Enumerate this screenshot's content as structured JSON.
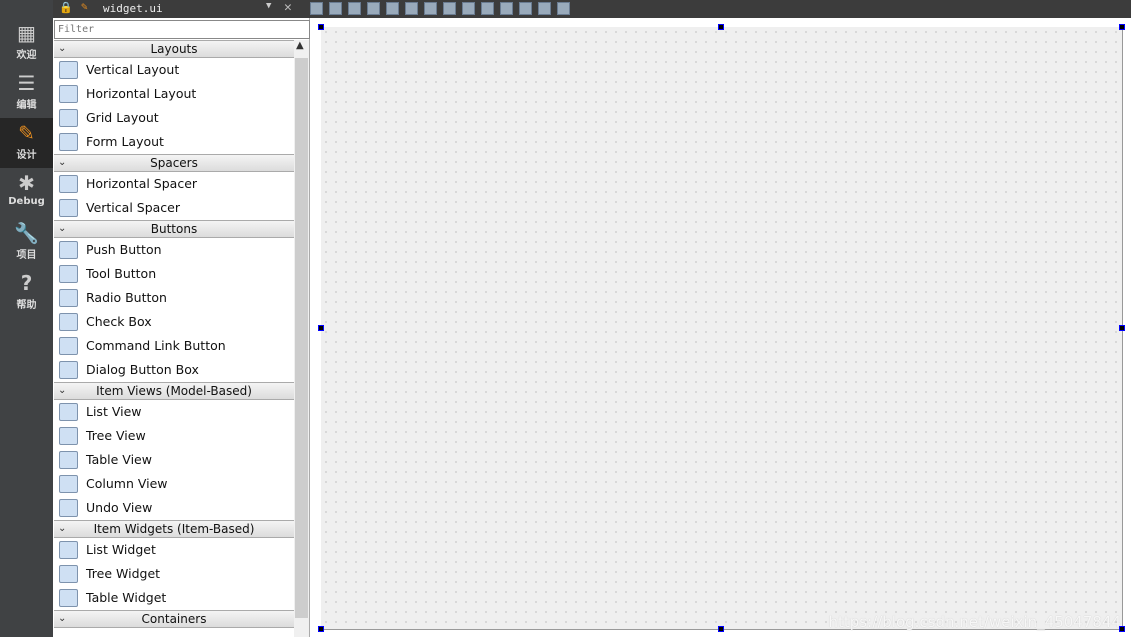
{
  "modes": [
    {
      "label": "欢迎",
      "icon": "grid-icon"
    },
    {
      "label": "编辑",
      "icon": "document-icon"
    },
    {
      "label": "设计",
      "icon": "pencil-icon",
      "active": true
    },
    {
      "label": "Debug",
      "icon": "bug-icon"
    },
    {
      "label": "项目",
      "icon": "wrench-icon"
    },
    {
      "label": "帮助",
      "icon": "help-icon"
    }
  ],
  "editor": {
    "file": "widget.ui"
  },
  "widget_box": {
    "filter_placeholder": "Filter",
    "categories": [
      {
        "name": "Layouts",
        "items": [
          "Vertical Layout",
          "Horizontal Layout",
          "Grid Layout",
          "Form Layout"
        ]
      },
      {
        "name": "Spacers",
        "items": [
          "Horizontal Spacer",
          "Vertical Spacer"
        ]
      },
      {
        "name": "Buttons",
        "items": [
          "Push Button",
          "Tool Button",
          "Radio Button",
          "Check Box",
          "Command Link Button",
          "Dialog Button Box"
        ]
      },
      {
        "name": "Item Views (Model-Based)",
        "items": [
          "List View",
          "Tree View",
          "Table View",
          "Column View",
          "Undo View"
        ]
      },
      {
        "name": "Item Widgets (Item-Based)",
        "items": [
          "List Widget",
          "Tree Widget",
          "Table Widget"
        ]
      },
      {
        "name": "Containers",
        "items": []
      }
    ]
  },
  "watermark": "https://blog.csdn.net/weixin_45047844"
}
